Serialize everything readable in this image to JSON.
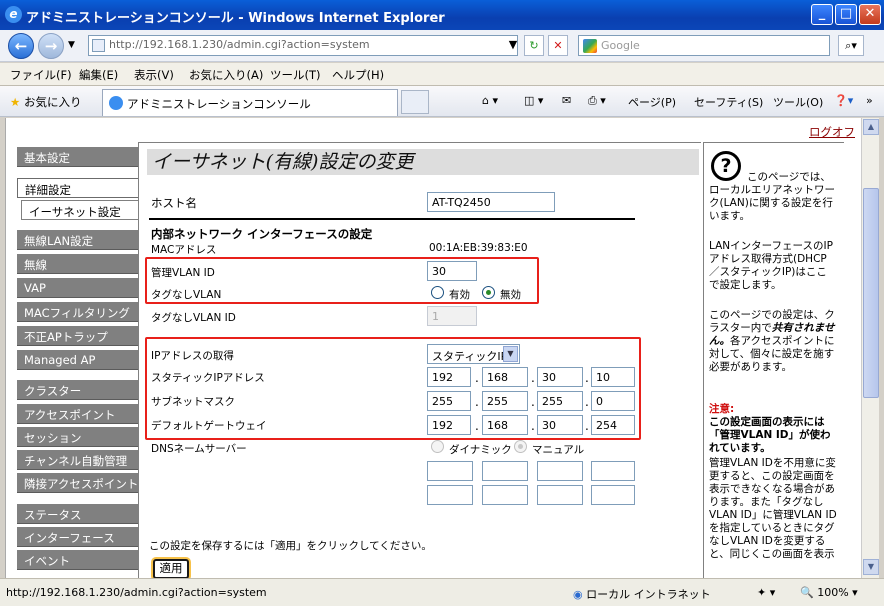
{
  "window": {
    "title": "アドミニストレーションコンソール - Windows Internet Explorer"
  },
  "address": {
    "url": "http://192.168.1.230/admin.cgi?action=system",
    "search_placeholder": "Google"
  },
  "menu": [
    "ファイル(F)",
    "編集(E)",
    "表示(V)",
    "お気に入り(A)",
    "ツール(T)",
    "ヘルプ(H)"
  ],
  "favorites": {
    "label": "お気に入り",
    "tab_title": "アドミニストレーションコンソール",
    "tools": [
      "ページ(P)",
      "セーフティ(S)",
      "ツール(O)"
    ]
  },
  "logoff": "ログオフ",
  "nav": {
    "basic": "基本設定",
    "advanced": "詳細設定",
    "ethernet": "イーサネット設定",
    "wlan": "無線LAN設定",
    "wireless": "無線",
    "vap": "VAP",
    "mac_filter": "MACフィルタリング",
    "rogue_ap": "不正APトラップ",
    "managed_ap": "Managed AP",
    "cluster": "クラスター",
    "access_point": "アクセスポイント",
    "session": "セッション",
    "channel_auto": "チャンネル自動管理",
    "neighbor_ap": "隣接アクセスポイント",
    "status": "ステータス",
    "interface": "インターフェース",
    "event": "イベント"
  },
  "page": {
    "title": "イーサネット(有線)設定の変更",
    "hostname_label": "ホスト名",
    "hostname_value": "AT-TQ2450",
    "internal_section": "内部ネットワーク インターフェースの設定",
    "mac_label": "MACアドレス",
    "mac_value": "00:1A:EB:39:83:E0",
    "mgmt_vlan_label": "管理VLAN ID",
    "mgmt_vlan_value": "30",
    "untagged_label": "タグなしVLAN",
    "untagged_enabled": "有効",
    "untagged_disabled": "無効",
    "untagged_id_label": "タグなしVLAN ID",
    "untagged_id_value": "1",
    "ip_mode_label": "IPアドレスの取得",
    "ip_mode_value": "スタティックIP",
    "static_ip_label": "スタティックIPアドレス",
    "static_ip": [
      "192",
      "168",
      "30",
      "10"
    ],
    "subnet_label": "サブネットマスク",
    "subnet": [
      "255",
      "255",
      "255",
      "0"
    ],
    "gateway_label": "デフォルトゲートウェイ",
    "gateway": [
      "192",
      "168",
      "30",
      "254"
    ],
    "dns_label": "DNSネームサーバー",
    "dns_dynamic": "ダイナミック",
    "dns_manual": "マニュアル",
    "save_note": "この設定を保存するには「適用」をクリックしてください。",
    "apply": "適用"
  },
  "help": {
    "p1": "このページでは、ローカルエリアネットワーク(LAN)に関する設定を行います。",
    "p2": "LANインターフェースのIPアドレス取得方式(DHCP／スタティックIP)はここで設定します。",
    "p3a": "このページでの設定は、クラスター内で",
    "p3b": "共有されません。",
    "p3c": "各アクセスポイントに対して、個々に設定を施す必要があります。",
    "warn_title": "注意:",
    "warn_bold": "この設定画面の表示には「管理VLAN ID」が使われています。",
    "warn_text": "管理VLAN IDを不用意に変更すると、この設定画面を表示できなくなる場合があります。また「タグなしVLAN ID」に管理VLAN IDを指定しているときにタグなしVLAN IDを変更すると、同じくこの画面を表示"
  },
  "statusbar": {
    "url": "http://192.168.1.230/admin.cgi?action=system",
    "zone": "ローカル イントラネット",
    "zoom": "100%"
  },
  "colors": {
    "highlight_box": "#e8201a",
    "nav_bg": "#808080",
    "title_bg": "#0a3fb0",
    "logoff": "#8b0000",
    "warning": "#d01010"
  }
}
